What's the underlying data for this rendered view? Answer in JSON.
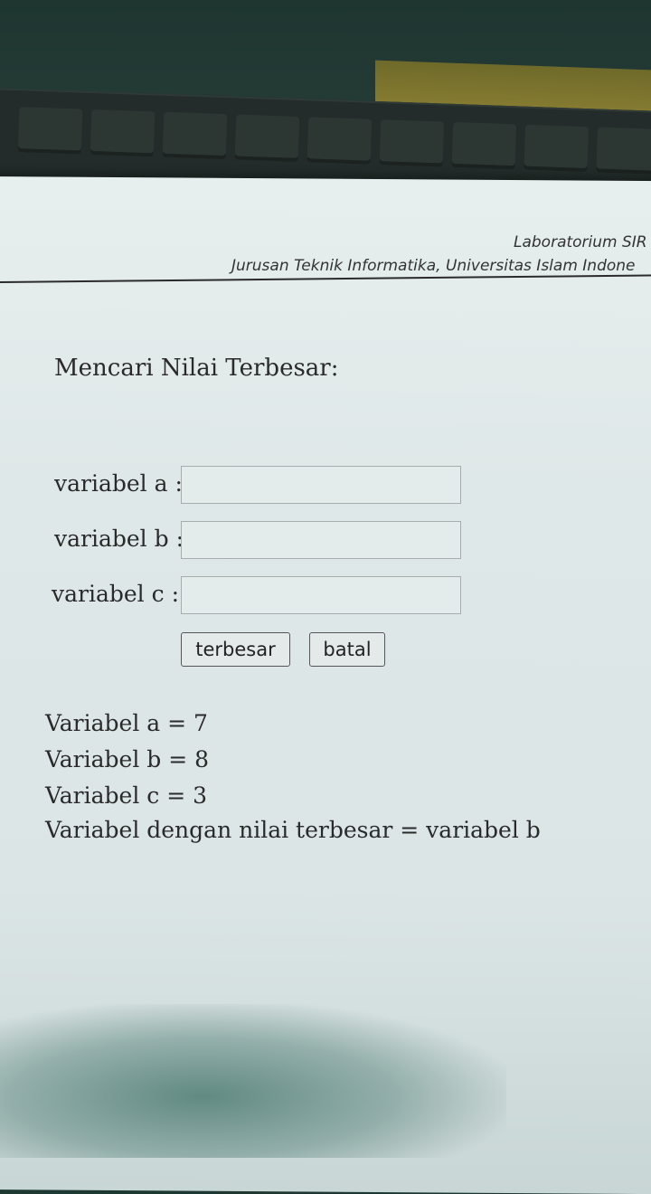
{
  "header": {
    "line1": "Laboratorium SIR",
    "line2": "Jurusan Teknik Informatika, Universitas Islam Indone"
  },
  "form": {
    "title": "Mencari Nilai Terbesar:",
    "fields": [
      {
        "label": "variabel a :",
        "value": ""
      },
      {
        "label": "variabel b :",
        "value": ""
      },
      {
        "label": "variabel c :",
        "value": ""
      }
    ],
    "buttons": {
      "submit": "terbesar",
      "cancel": "batal"
    }
  },
  "results": [
    "Variabel a = 7",
    "Variabel b = 8",
    "Variabel c = 3",
    "Variabel dengan nilai terbesar = variabel b"
  ]
}
